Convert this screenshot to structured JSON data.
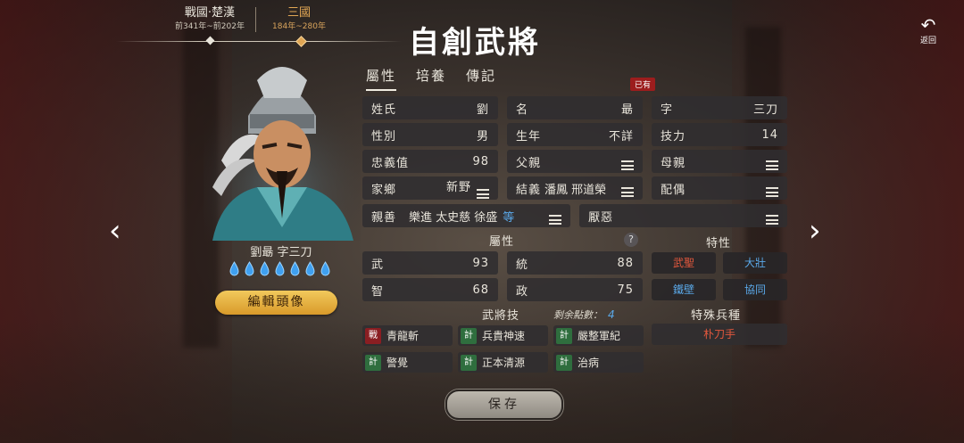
{
  "eras": [
    {
      "name": "戰國·楚漢",
      "years": "前341年~前202年",
      "active": false
    },
    {
      "name": "三國",
      "years": "184年~280年",
      "active": true
    }
  ],
  "title": "自創武將",
  "back_label": "返回",
  "tabs": [
    {
      "label": "屬性",
      "active": true
    },
    {
      "label": "培養",
      "active": false
    },
    {
      "label": "傳記",
      "active": false
    }
  ],
  "badge": "已有",
  "character": {
    "name": "劉朂 字三刀",
    "drop_count": 7,
    "edit_label": "編輯頭像"
  },
  "fields": {
    "surname": {
      "label": "姓氏",
      "value": "劉"
    },
    "given": {
      "label": "名",
      "value": "朂"
    },
    "style": {
      "label": "字",
      "value": "三刀"
    },
    "gender": {
      "label": "性別",
      "value": "男"
    },
    "birth": {
      "label": "生年",
      "value": "不詳"
    },
    "skill_power": {
      "label": "技力",
      "value": "14"
    },
    "loyalty": {
      "label": "忠義值",
      "value": "98"
    },
    "father": {
      "label": "父親"
    },
    "mother": {
      "label": "母親"
    },
    "hometown": {
      "label": "家鄉",
      "value": "新野"
    },
    "sworn": {
      "label": "結義",
      "value": "潘鳳 邢道榮"
    },
    "spouse": {
      "label": "配偶"
    },
    "friends": {
      "label": "親善",
      "value": "樂進 太史慈 徐盛",
      "more": "等"
    },
    "dislike": {
      "label": "厭惡"
    }
  },
  "attributes": {
    "header": "屬性",
    "help": "?",
    "war": {
      "label": "武",
      "value": "93"
    },
    "lead": {
      "label": "統",
      "value": "88"
    },
    "intel": {
      "label": "智",
      "value": "68"
    },
    "politics": {
      "label": "政",
      "value": "75"
    }
  },
  "traits": {
    "header": "特性",
    "items": [
      {
        "label": "武聖",
        "color": "#e4583d"
      },
      {
        "label": "大壯",
        "color": "#5aa8e8"
      },
      {
        "label": "鐵壁",
        "color": "#5aa8e8"
      },
      {
        "label": "協同",
        "color": "#5aa8e8"
      }
    ]
  },
  "skills": {
    "header": "武將技",
    "remaining_label": "剩余點數：",
    "remaining": "4",
    "items": [
      {
        "tag": "戰",
        "label": "青龍斬"
      },
      {
        "tag": "計",
        "label": "兵貴神速"
      },
      {
        "tag": "計",
        "label": "嚴整軍紀"
      },
      {
        "tag": "計",
        "label": "警覺"
      },
      {
        "tag": "計",
        "label": "正本清源"
      },
      {
        "tag": "計",
        "label": "治病"
      }
    ]
  },
  "special_troop": {
    "header": "特殊兵種",
    "value": "朴刀手"
  },
  "save_label": "保存"
}
